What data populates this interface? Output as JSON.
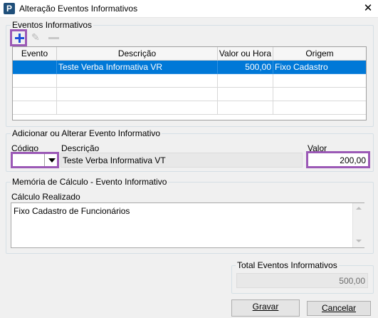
{
  "window": {
    "title": "Alteração Eventos Informativos",
    "close_glyph": "✕"
  },
  "eventos": {
    "group_label": "Eventos Informativos",
    "columns": [
      "Evento",
      "Descrição",
      "Valor ou Hora",
      "Origem"
    ],
    "rows": [
      {
        "evento": "",
        "descricao": "Teste Verba Informativa VR",
        "valor": "500,00",
        "origem": "Fixo Cadastro"
      }
    ]
  },
  "adicionar": {
    "group_label": "Adicionar ou Alterar Evento Informativo",
    "codigo_label": "Código",
    "codigo_value": "",
    "descricao_label": "Descrição",
    "descricao_value": "Teste Verba Informativa VT",
    "valor_label": "Valor",
    "valor_value": "200,00"
  },
  "memoria": {
    "group_label": "Memória de Cálculo - Evento Informativo",
    "calculo_label": "Cálculo Realizado",
    "calculo_text": "Fixo Cadastro de Funcionários"
  },
  "total": {
    "group_label": "Total Eventos Informativos",
    "value": "500,00"
  },
  "buttons": {
    "gravar": "Gravar",
    "cancelar": "Cancelar"
  },
  "colors": {
    "selection": "#0078d7",
    "highlight": "#9b59b6",
    "add_icon": "#1d50d8"
  }
}
